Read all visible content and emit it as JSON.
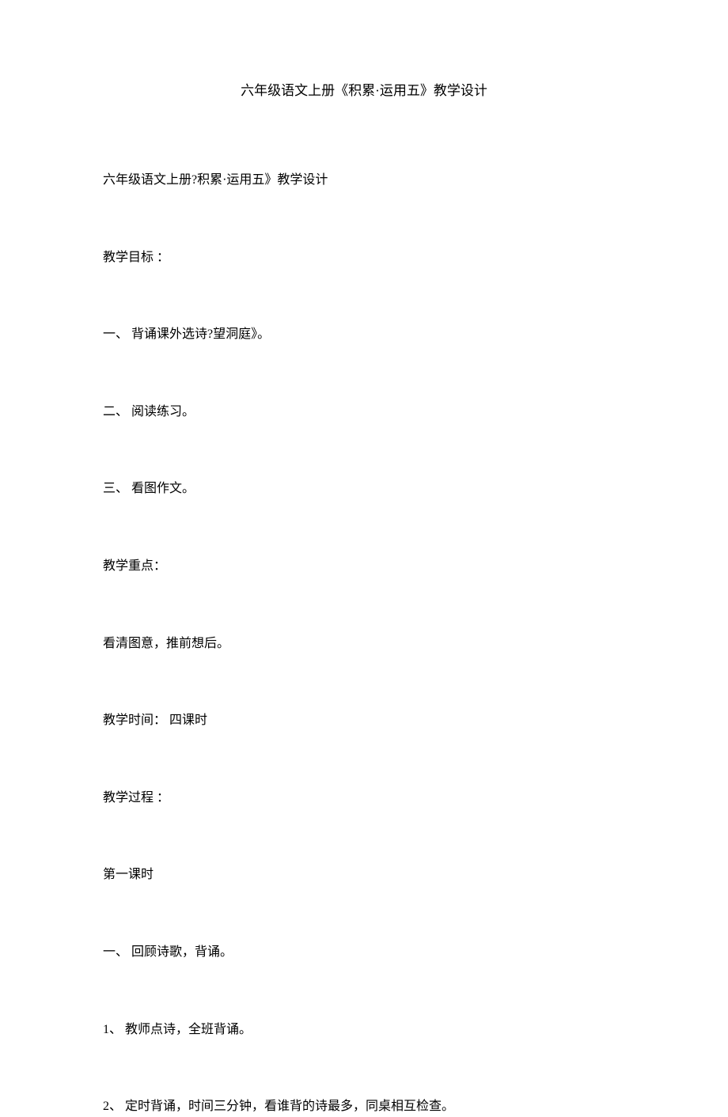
{
  "title": "六年级语文上册《积累·运用五》教学设计",
  "lines": [
    "六年级语文上册?积累·运用五》教学设计",
    "教学目标 ：",
    "一、 背诵课外选诗?望洞庭》。",
    "二、 阅读练习。",
    "三、 看图作文。",
    "教学重点：",
    "看清图意，推前想后。",
    "教学时间： 四课时",
    "教学过程 ：",
    "第一课时",
    "一、 回顾诗歌，背诵。",
    "1、 教师点诗，全班背诵。",
    "2、 定时背诵，时间三分钟，看谁背的诗最多，同桌相互检查。"
  ]
}
